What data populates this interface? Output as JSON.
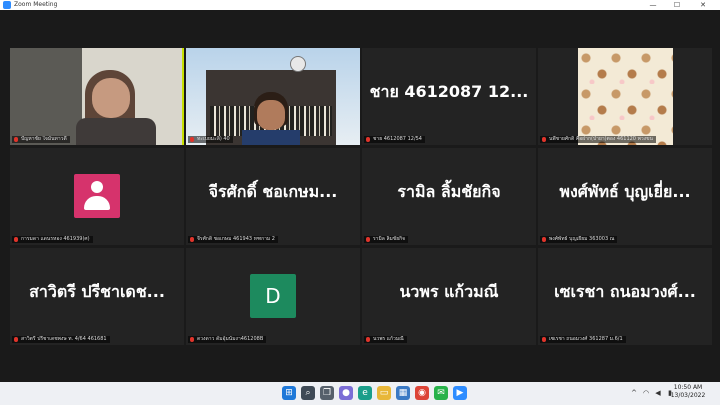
{
  "window": {
    "title": "Zoom Meeting",
    "minimize": "—",
    "maximize": "☐",
    "close": "✕"
  },
  "tiles": [
    {
      "label": "ปัญหาชัย ใจมั่นทาวดี",
      "active": true
    },
    {
      "label": "ทะเบยมะลิ) 40"
    },
    {
      "big": "ชาย 4612087 12...",
      "label": "ชาย 4612087 12/54"
    },
    {
      "label": "นพีชายศักดิ์ คือฝาก(ป่ายา)ตอง 461120 พวงขน"
    },
    {
      "label": "การมดา แดนรหอง 461939(ศ)"
    },
    {
      "big": "จีรศักดิ์ ชอเกษม...",
      "label": "จีรศักดิ์ ชอเกษม 461943 หฑกาม 2"
    },
    {
      "big": "รามิล ลิ้มชัยกิจ",
      "label": "รามิล ลิ้มชัยกิจ"
    },
    {
      "big": "พงศ์พัทธ์ บุญเยี่ย...",
      "label": "พงศ์พัทธ์ บุญเยี่ยม 363003 ณ"
    },
    {
      "big": "สาวิตรี ปรีชาเดช...",
      "label": "สาวิตรี ปรีชาเดชพงษ ท. 4/64 461681"
    },
    {
      "avatar_letter": "D",
      "label": "ดวงดาว ดัมอุ้มนัมงา461208B"
    },
    {
      "big": "นวพร แก้วมณี",
      "label": "นวพร แก้วมณี"
    },
    {
      "big": "เซเรชา ถนอมวงศ์...",
      "label": "เซเรชา ถนอมวงศ์ 361287 ม.6/1"
    }
  ],
  "taskbar": {
    "icons": [
      "windows-icon",
      "search-icon",
      "task-view-icon",
      "chat-icon",
      "edge-icon",
      "file-explorer-icon",
      "store-icon",
      "chrome-icon",
      "line-icon",
      "zoom-icon"
    ],
    "tray": {
      "chevron": "^",
      "wifi": "wifi",
      "volume": "vol",
      "battery": "bat"
    },
    "time": "10:50 AM",
    "date": "13/03/2022"
  },
  "colors": {
    "active_outline": "#c8e000",
    "mic_muted": "#e0342b",
    "avatar_pink": "#d6336c",
    "avatar_green": "#1d8a5e"
  }
}
